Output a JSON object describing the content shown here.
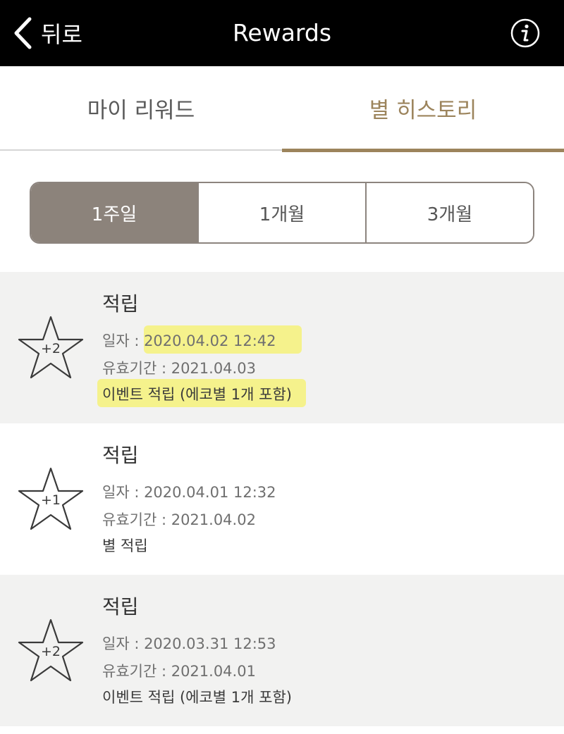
{
  "header": {
    "back_label": "뒤로",
    "title": "Rewards",
    "info_icon": "info-icon"
  },
  "tabs": [
    {
      "label": "마이 리워드",
      "active": false
    },
    {
      "label": "별 히스토리",
      "active": true
    }
  ],
  "period_filter": [
    {
      "label": "1주일",
      "active": true
    },
    {
      "label": "1개월",
      "active": false
    },
    {
      "label": "3개월",
      "active": false
    }
  ],
  "history": [
    {
      "title": "적립",
      "stars": "+2",
      "date": "일자 : 2020.04.02 12:42",
      "expiry": "유효기간 : 2021.04.03",
      "note": "이벤트 적립 (에코별 1개 포함)"
    },
    {
      "title": "적립",
      "stars": "+1",
      "date": "일자 : 2020.04.01 12:32",
      "expiry": "유효기간 : 2021.04.02",
      "note": "별 적립"
    },
    {
      "title": "적립",
      "stars": "+2",
      "date": "일자 : 2020.03.31 12:53",
      "expiry": "유효기간 : 2021.04.01",
      "note": "이벤트 적립 (에코별 1개 포함)"
    }
  ],
  "colors": {
    "header_bg": "#000000",
    "accent": "#9c845c",
    "segment_active": "#8c837b",
    "highlight": "#f6f27a"
  }
}
